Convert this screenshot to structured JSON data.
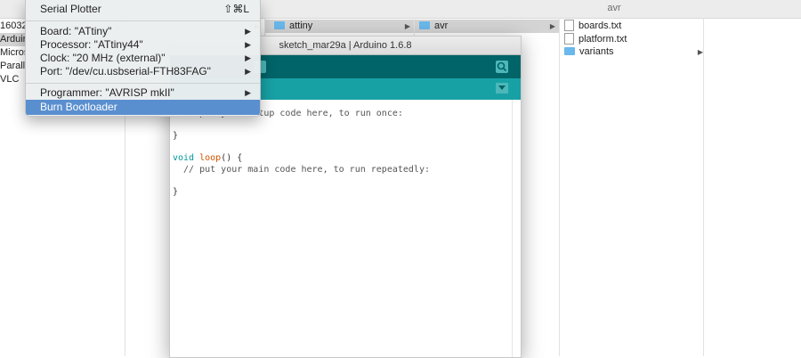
{
  "finder": {
    "column_title": "avr",
    "col1_items": [
      "16032",
      "Arduin",
      "Micros",
      "Paralle",
      "VLC"
    ],
    "col3_item": "attiny",
    "col4_item": "avr",
    "col5_items": [
      {
        "label": "boards.txt",
        "kind": "file"
      },
      {
        "label": "platform.txt",
        "kind": "file"
      },
      {
        "label": "variants",
        "kind": "folder"
      }
    ]
  },
  "arduino": {
    "window_title": "sketch_mar29a | Arduino 1.6.8",
    "code": {
      "line1": "  // put your setup code here, to run once:",
      "line2": "}",
      "line3_kw": "void",
      "line3_fn": "loop",
      "line3_rest": "() {",
      "line4": "  // put your main code here, to run repeatedly:",
      "line5": "}"
    }
  },
  "menu": {
    "serial_plotter": "Serial Plotter",
    "serial_plotter_shortcut": "⇧⌘L",
    "board": "Board: \"ATtiny\"",
    "processor": "Processor: \"ATtiny44\"",
    "clock": "Clock: \"20 MHz (external)\"",
    "port": "Port: \"/dev/cu.usbserial-FTH83FAG\"",
    "programmer": "Programmer: \"AVRISP mkII\"",
    "burn_bootloader": "Burn Bootloader"
  },
  "icons": {
    "submenu_arrow": "▶",
    "finder_chevron": "▶"
  }
}
